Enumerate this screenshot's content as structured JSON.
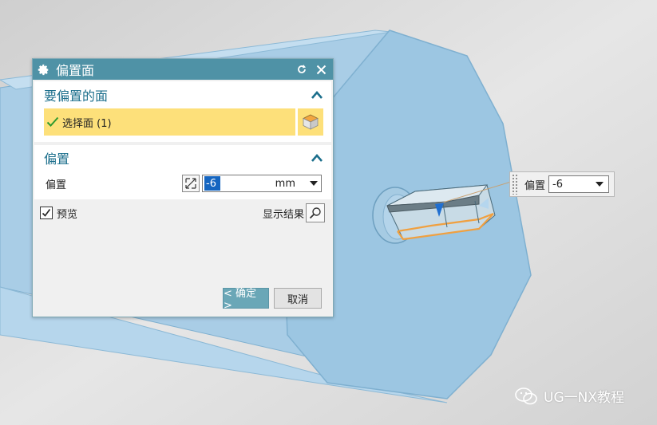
{
  "dialog": {
    "title": "偏置面",
    "section_faces": {
      "header": "要偏置的面",
      "select_label": "选择面 (1)"
    },
    "section_offset": {
      "header": "偏置",
      "field_label": "偏置",
      "value": "-6",
      "unit": "mm"
    },
    "preview": {
      "label": "预览",
      "checked": true,
      "show_result_label": "显示结果"
    },
    "ok_label": "< 确定 >",
    "cancel_label": "取消"
  },
  "handle": {
    "label": "偏置",
    "value": "-6"
  },
  "watermark": "UG一NX教程",
  "colors": {
    "title_bar": "#4f92a6",
    "section_header_text": "#1c6f8c",
    "selection_highlight": "#fde07a",
    "ok_button": "#6aa7b7",
    "model_blue": "#9cc6e2",
    "selected_edge": "#f0a040"
  }
}
